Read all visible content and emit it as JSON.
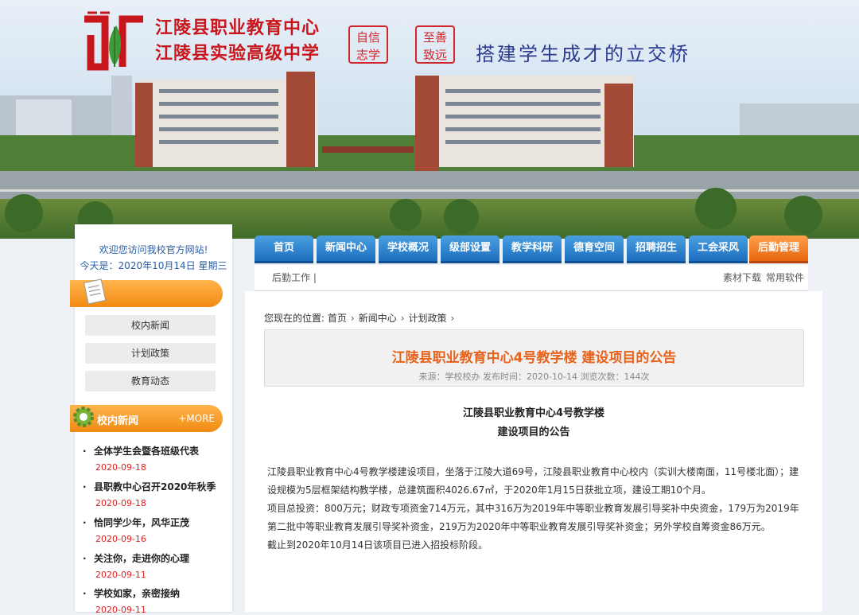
{
  "header": {
    "school_names": [
      "江陵县职业教育中心",
      "江陵县实验高级中学"
    ],
    "seal_left": [
      "自信",
      "志学"
    ],
    "seal_right": [
      "至善",
      "致远"
    ],
    "motto": "搭建学生成才的立交桥"
  },
  "sidebar": {
    "welcome": "欢迎您访问我校官方网站!",
    "today": "今天是：2020年10月14日 星期三",
    "links": [
      "校内新闻",
      "计划政策",
      "教育动态"
    ],
    "news_heading": "校内新闻",
    "more_label": "+MORE",
    "news": [
      {
        "title": "全体学生会暨各班级代表",
        "date": "2020-09-18"
      },
      {
        "title": "县职教中心召开2020年秋季",
        "date": "2020-09-18"
      },
      {
        "title": "恰同学少年，风华正茂",
        "date": "2020-09-16"
      },
      {
        "title": "关注你，走进你的心理",
        "date": "2020-09-11"
      },
      {
        "title": "学校如家，亲密接纳",
        "date": "2020-09-11"
      }
    ]
  },
  "nav": {
    "tabs": [
      "首页",
      "新闻中心",
      "学校概况",
      "级部设置",
      "教学科研",
      "德育空间",
      "招聘招生",
      "工会采风",
      "后勤管理"
    ],
    "active_index": 8,
    "sub_left": "后勤工作 |",
    "sub_right": [
      "素材下载",
      "常用软件"
    ]
  },
  "breadcrumb": {
    "label": "您现在的位置:",
    "items": [
      "首页",
      "新闻中心",
      "计划政策"
    ]
  },
  "article": {
    "title": "江陵县职业教育中心4号教学楼 建设项目的公告",
    "meta": "来源：学校校办  发布时间：2020-10-14  浏览次数：144次",
    "heading_line1": "江陵县职业教育中心4号教学楼",
    "heading_line2": "建设项目的公告",
    "paragraphs": [
      "江陵县职业教育中心4号教学楼建设项目，坐落于江陵大道69号，江陵县职业教育中心校内（实训大楼南面，11号楼北面）；建设规模为5层框架结构教学楼，总建筑面积4026.67㎡，于2020年1月15日获批立项，建设工期10个月。",
      "项目总投资：800万元；财政专项资金714万元，其中316万为2019年中等职业教育发展引导奖补中央资金，179万为2019年第二批中等职业教育发展引导奖补资金，219万为2020年中等职业教育发展引导奖补资金；另外学校自筹资金86万元。",
      "截止到2020年10月14日该项目已进入招投标阶段。"
    ]
  },
  "colors": {
    "brand_red": "#c8161d",
    "nav_blue": "#1e6fbf",
    "accent_orange": "#e8650f"
  }
}
